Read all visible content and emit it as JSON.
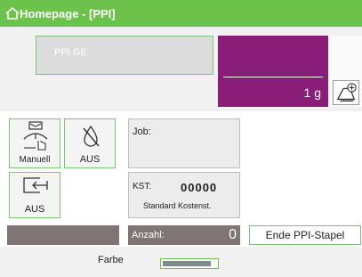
{
  "header": {
    "title": "Homepage - [PPI]"
  },
  "ppi_field": {
    "text": "PPI GE"
  },
  "weight": {
    "value": "1 g"
  },
  "tiles": {
    "manuell": {
      "label": "Manuell"
    },
    "ink_off": {
      "label": "AUS"
    },
    "feeder_off": {
      "label": "AUS"
    }
  },
  "job": {
    "label": "Job:"
  },
  "kst": {
    "label": "KST:",
    "value": "00000",
    "description": "Standard Kostenst."
  },
  "anzahl": {
    "label": "Anzahl:",
    "value": "0"
  },
  "buttons": {
    "ende": "Ende PPI-Stapel"
  },
  "farbe": {
    "label": "Farbe",
    "level": 0.9
  },
  "colors": {
    "header": "#6cc24a",
    "weight_panel": "#8a1d77",
    "accent_border": "#7bc47f"
  },
  "icons": [
    "home-icon",
    "scale-add-icon",
    "manual-weight-icon",
    "ink-off-icon",
    "feeder-off-icon"
  ]
}
